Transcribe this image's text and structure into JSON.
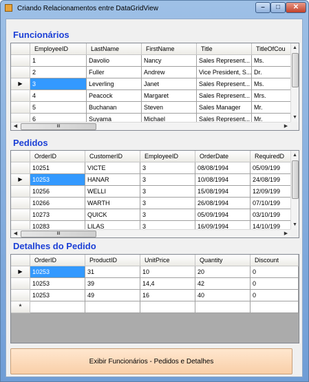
{
  "window": {
    "title": "Criando Relacionamentos entre DataGridView",
    "minimize_glyph": "–",
    "maximize_glyph": "□",
    "close_glyph": "✕"
  },
  "sections": {
    "employees_label": "Funcionários",
    "orders_label": "Pedidos",
    "details_label": "Detalhes do Pedido"
  },
  "employees": {
    "columns": [
      "EmployeeID",
      "LastName",
      "FirstName",
      "Title",
      "TitleOfCou"
    ],
    "rows": [
      [
        "1",
        "Davolio",
        "Nancy",
        "Sales Represent...",
        "Ms."
      ],
      [
        "2",
        "Fuller",
        "Andrew",
        "Vice President, S...",
        "Dr."
      ],
      [
        "3",
        "Leverling",
        "Janet",
        "Sales Represent...",
        "Ms."
      ],
      [
        "4",
        "Peacock",
        "Margaret",
        "Sales Represent...",
        "Mrs."
      ],
      [
        "5",
        "Buchanan",
        "Steven",
        "Sales Manager",
        "Mr."
      ],
      [
        "6",
        "Suyama",
        "Michael",
        "Sales Represent...",
        "Mr."
      ]
    ],
    "selected_row": 2,
    "scroll_glyph": "III"
  },
  "orders": {
    "columns": [
      "OrderID",
      "CustomerID",
      "EmployeeID",
      "OrderDate",
      "RequiredD"
    ],
    "rows": [
      [
        "10251",
        "VICTE",
        "3",
        "08/08/1994",
        "05/09/199"
      ],
      [
        "10253",
        "HANAR",
        "3",
        "10/08/1994",
        "24/08/199"
      ],
      [
        "10256",
        "WELLI",
        "3",
        "15/08/1994",
        "12/09/199"
      ],
      [
        "10266",
        "WARTH",
        "3",
        "26/08/1994",
        "07/10/199"
      ],
      [
        "10273",
        "QUICK",
        "3",
        "05/09/1994",
        "03/10/199"
      ],
      [
        "10283",
        "LILAS",
        "3",
        "16/09/1994",
        "14/10/199"
      ]
    ],
    "selected_row": 1,
    "scroll_glyph": "III"
  },
  "details": {
    "columns": [
      "OrderID",
      "ProductID",
      "UnitPrice",
      "Quantity",
      "Discount"
    ],
    "rows": [
      [
        "10253",
        "31",
        "10",
        "20",
        "0"
      ],
      [
        "10253",
        "39",
        "14,4",
        "42",
        "0"
      ],
      [
        "10253",
        "49",
        "16",
        "40",
        "0"
      ]
    ],
    "selected_row": 0,
    "new_row_marker": "*"
  },
  "row_indicator": "▶",
  "action_button_label": "Exibir Funcionários - Pedidos e Detalhes"
}
